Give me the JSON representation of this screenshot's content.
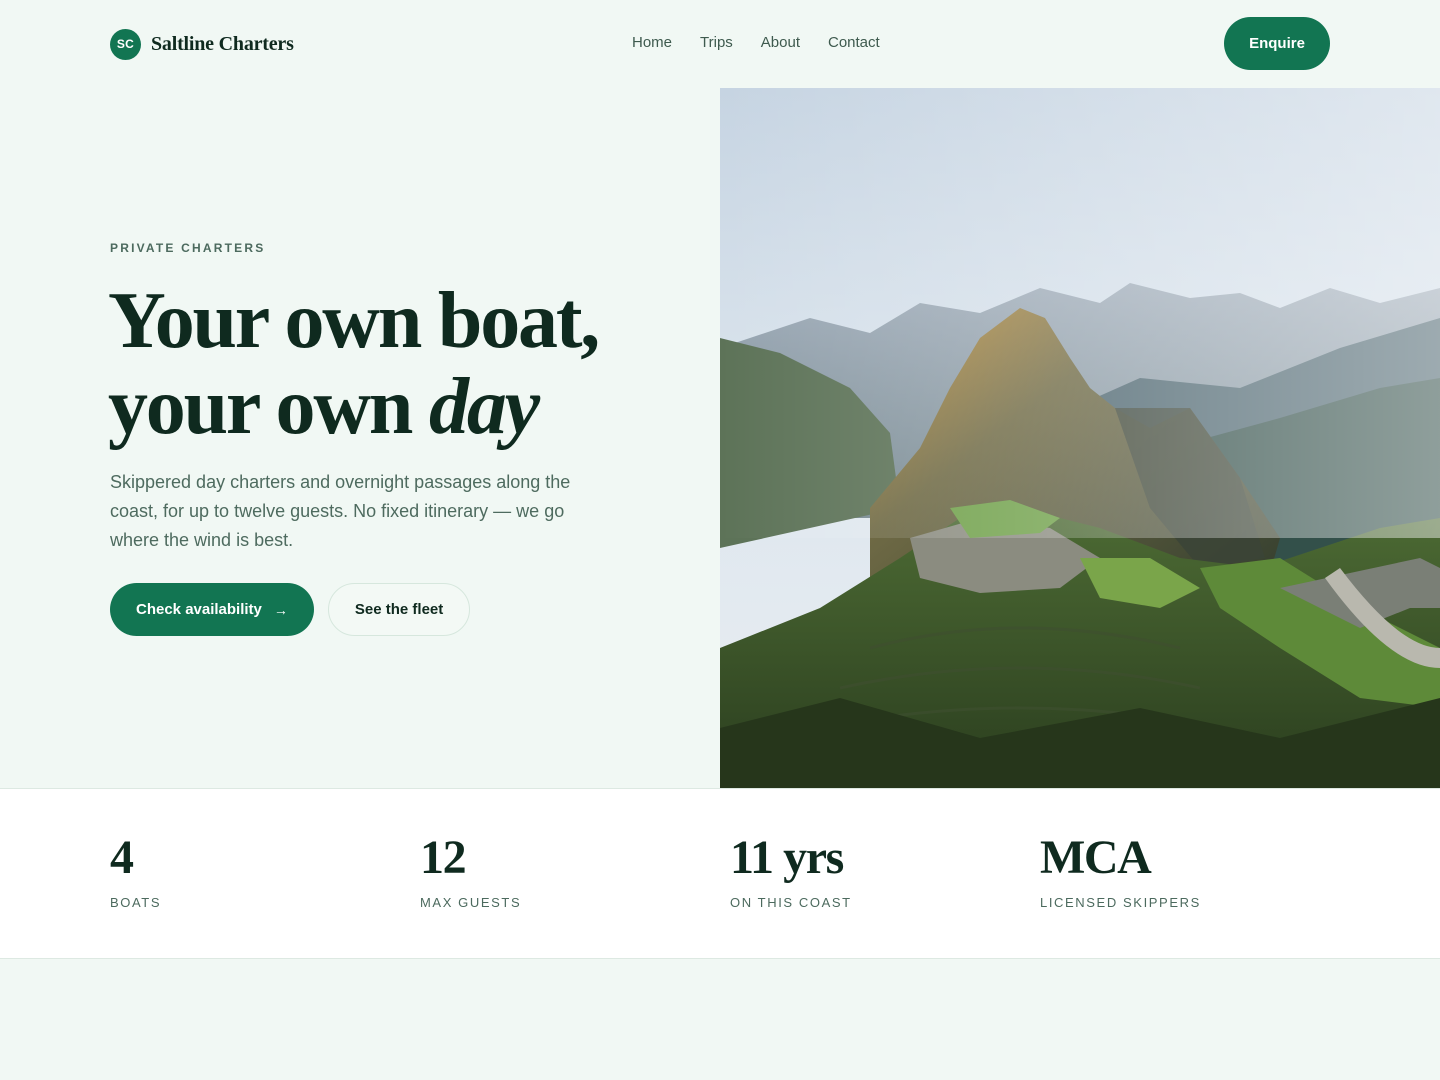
{
  "brand": {
    "initials": "SC",
    "name": "Saltline Charters"
  },
  "nav": {
    "items": [
      "Home",
      "Trips",
      "About",
      "Contact"
    ]
  },
  "header": {
    "cta_label": "Enquire"
  },
  "hero": {
    "eyebrow": "PRIVATE CHARTERS",
    "headline_line1": "Your own boat,",
    "headline_line2_prefix": "your own ",
    "headline_line2_emphasis": "day",
    "lede": "Skippered day charters and overnight passages along the coast, for up to twelve guests. No fixed itinerary — we go where the wind is best.",
    "primary_cta": "Check availability",
    "primary_cta_icon": "→",
    "secondary_cta": "See the fleet"
  },
  "stats": [
    {
      "value": "4",
      "label": "BOATS"
    },
    {
      "value": "12",
      "label": "MAX GUESTS"
    },
    {
      "value": "11 yrs",
      "label": "ON THIS COAST"
    },
    {
      "value": "MCA",
      "label": "LICENSED SKIPPERS"
    }
  ],
  "colors": {
    "accent": "#127552",
    "page_background": "#f1f8f4",
    "heading": "#0f2a1f",
    "body_text": "#4e6b5f"
  }
}
